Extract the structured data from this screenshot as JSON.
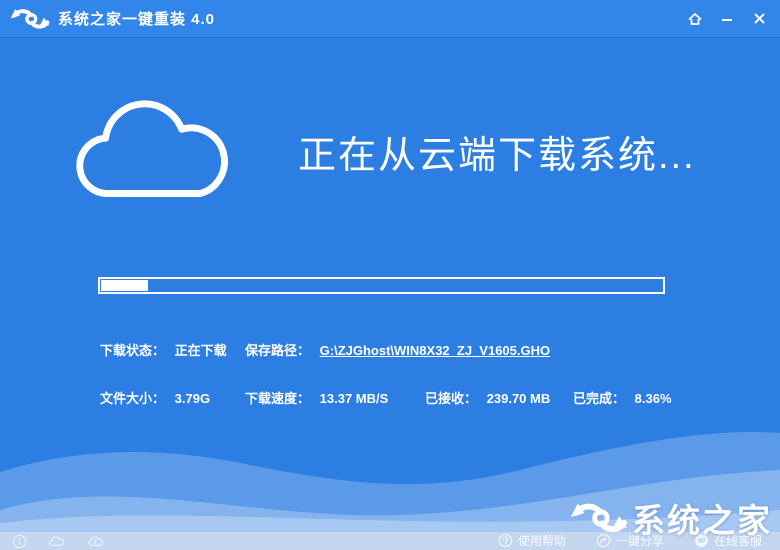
{
  "titlebar": {
    "title": "系统之家一键重装 4.0"
  },
  "main": {
    "headline": "正在从云端下载系统...",
    "progress": {
      "percent": "8.36",
      "fill_style": "width:8.36%"
    },
    "stats": [
      {
        "label": "下载状态：",
        "value": "正在下载"
      },
      {
        "label": "保存路径：",
        "value": "G:\\ZJGhost\\WIN8X32_ZJ_V1605.GHO"
      },
      {
        "label": "文件大小：",
        "value": "3.79G"
      },
      {
        "label": "下载速度：",
        "value": "13.37 MB/S"
      },
      {
        "label": "已接收：",
        "value": "239.70 MB"
      },
      {
        "label": "已完成：",
        "value": "8.36%"
      }
    ]
  },
  "footer": {
    "help": "使用帮助",
    "share": "一键分享",
    "service": "在线客服"
  },
  "watermark": {
    "brand": "系统之家"
  },
  "icons": {
    "titlebar_logo": "brand-swoosh-icon",
    "left": [
      "info-icon",
      "cloud-icon",
      "cloud-bolt-icon"
    ],
    "controls": [
      "home-icon",
      "minimize-icon",
      "close-icon"
    ]
  },
  "colors": {
    "titlebar": "#3285e9",
    "background": "#2d7ee2",
    "footer_bar": "#c4d7ef",
    "text": "#ffffff"
  }
}
